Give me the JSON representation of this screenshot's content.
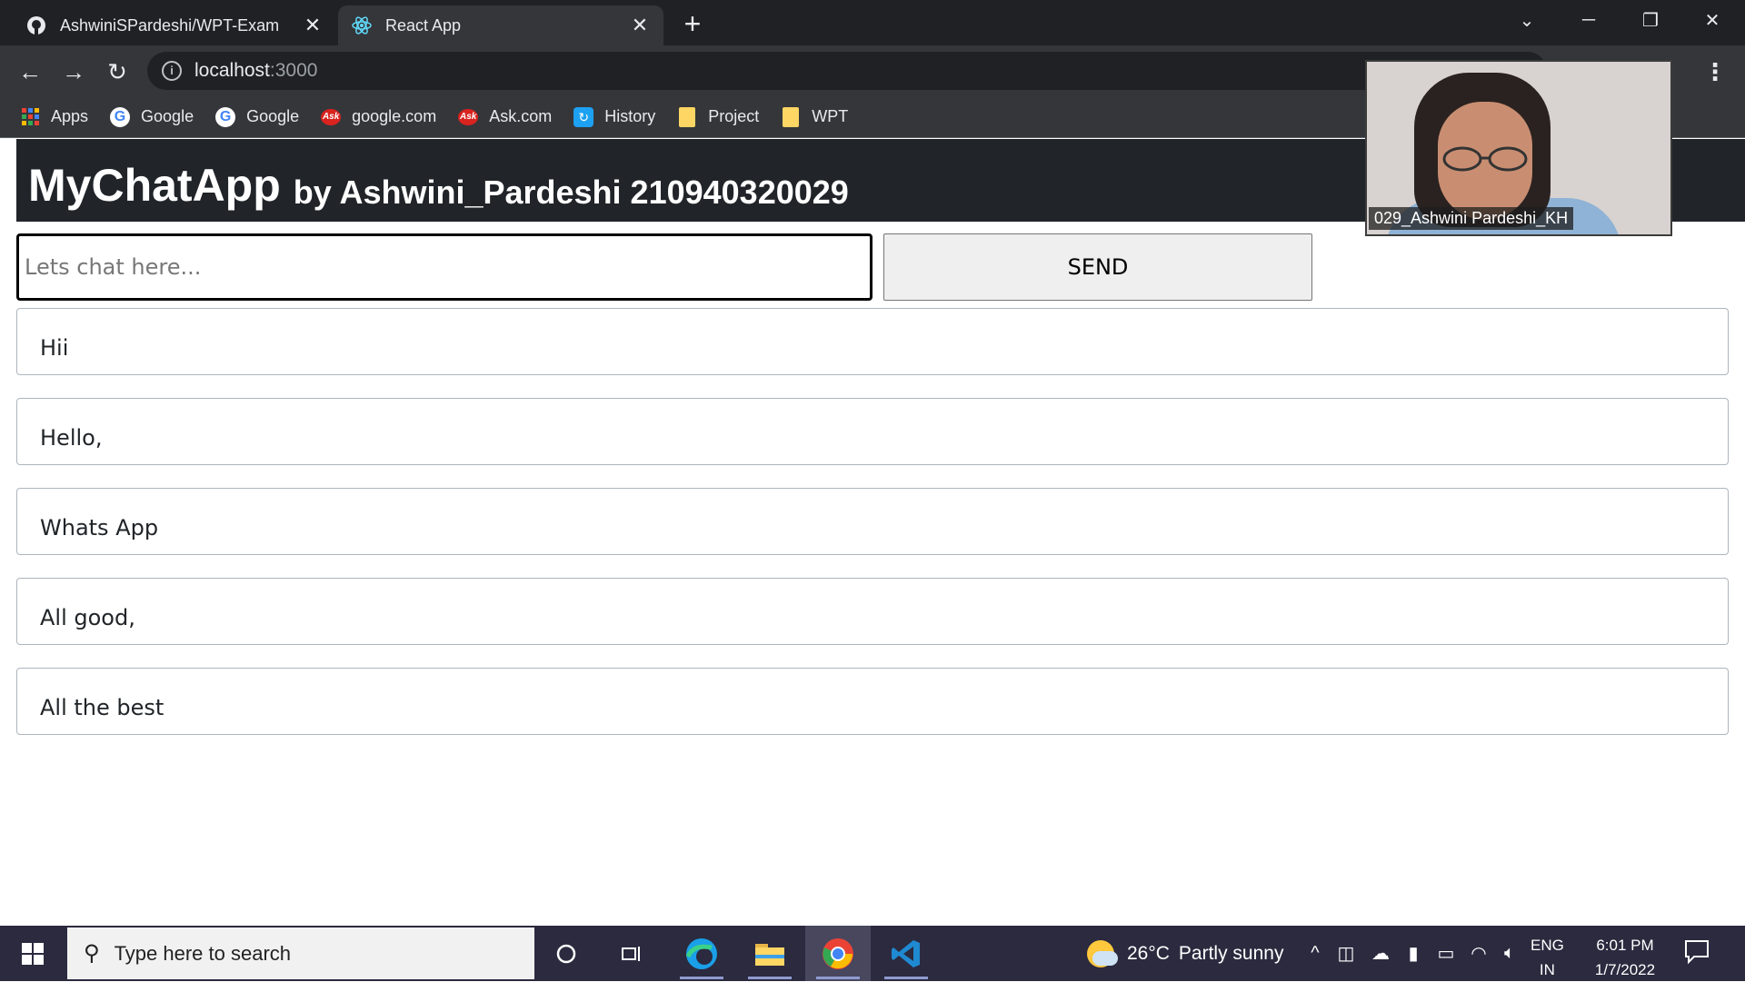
{
  "browser": {
    "tabs": [
      {
        "title": "AshwiniSPardeshi/WPT-Exam",
        "icon": "github-icon"
      },
      {
        "title": "React App",
        "icon": "react-icon"
      }
    ],
    "url_host": "localhost",
    "url_port": ":3000",
    "bookmarks": [
      {
        "label": "Apps",
        "icon": "apps-grid-icon"
      },
      {
        "label": "Google",
        "icon": "google-icon"
      },
      {
        "label": "Google",
        "icon": "google-icon"
      },
      {
        "label": "google.com",
        "icon": "ask-icon"
      },
      {
        "label": "Ask.com",
        "icon": "ask-icon"
      },
      {
        "label": "History",
        "icon": "history-icon"
      },
      {
        "label": "Project",
        "icon": "folder-icon"
      },
      {
        "label": "WPT",
        "icon": "folder-icon"
      }
    ]
  },
  "app": {
    "brand": "MyChatApp",
    "subtitle": "by Ashwini_Pardeshi 210940320029",
    "input_placeholder": "Lets chat here...",
    "send_label": "SEND",
    "messages": [
      "Hii",
      "Hello,",
      "Whats App",
      "All good,",
      "All the best"
    ]
  },
  "video_overlay": {
    "participant": "029_Ashwini Pardeshi_KH"
  },
  "taskbar": {
    "search_placeholder": "Type here to search",
    "weather": {
      "temp": "26°C",
      "condition": "Partly sunny"
    },
    "lang_top": "ENG",
    "lang_bottom": "IN",
    "time": "6:01 PM",
    "date": "1/7/2022"
  }
}
